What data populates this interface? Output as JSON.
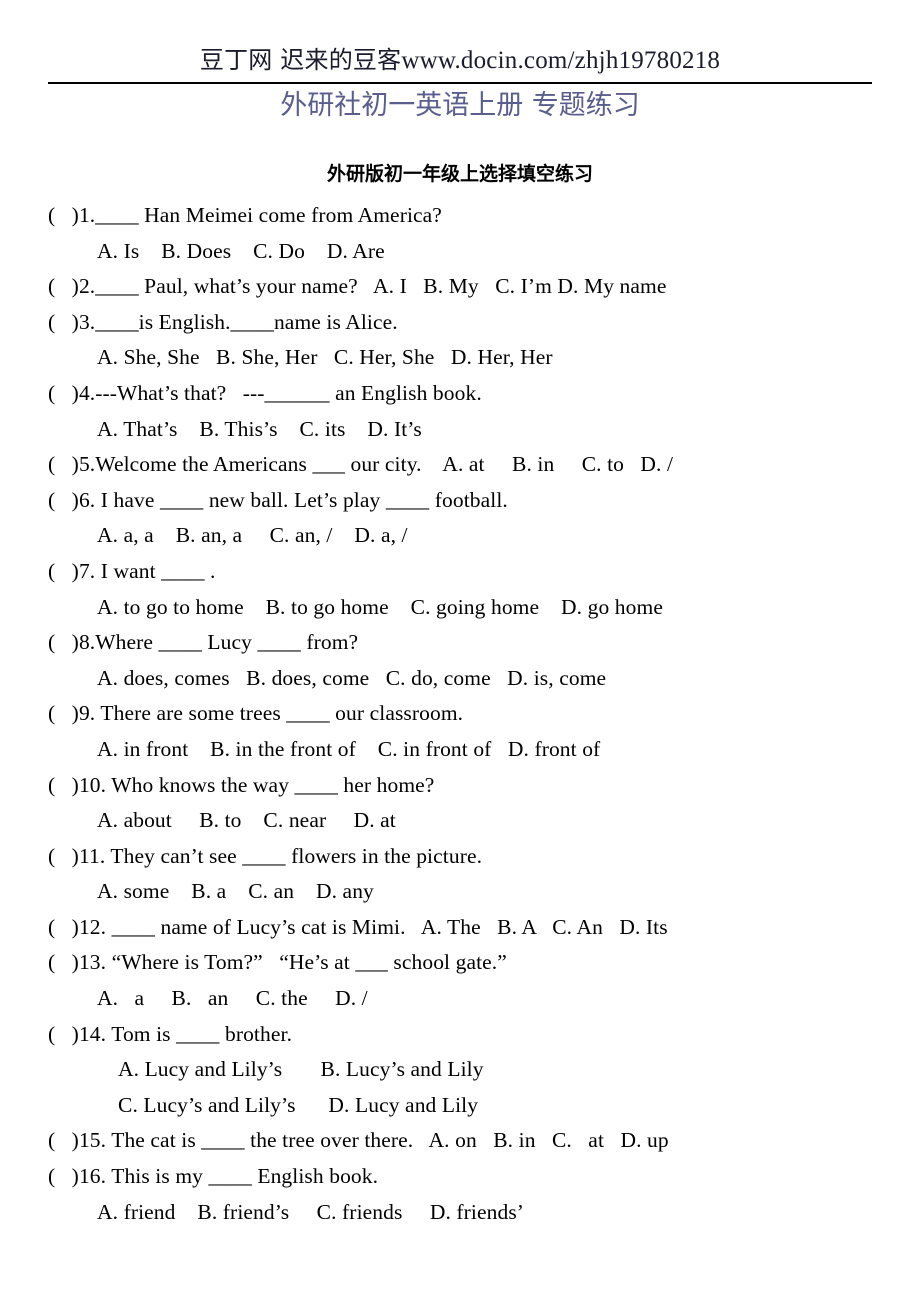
{
  "header": {
    "watermark_cn": "豆丁网  迟来的豆客",
    "watermark_url": "www.docin.com/zhjh19780218"
  },
  "title": "外研社初一英语上册  专题练习",
  "subtitle": "外研版初一年级上选择填空练习",
  "colors": {
    "title_blue": "#5a5e8e",
    "text_black": "#000000",
    "rule": "#000000"
  },
  "lines": [
    {
      "kind": "question",
      "text": "(   )1.____ Han Meimei come from America?"
    },
    {
      "kind": "option",
      "text": "A. Is    B. Does    C. Do    D. Are"
    },
    {
      "kind": "question",
      "text": "(   )2.____ Paul, what’s your name?   A. I   B. My   C. I’m D. My name"
    },
    {
      "kind": "question",
      "text": "(   )3.____is English.____name is Alice."
    },
    {
      "kind": "option",
      "text": "A. She, She   B. She, Her   C. Her, She   D. Her, Her"
    },
    {
      "kind": "question",
      "text": "(   )4.---What’s that?   ---______ an English book."
    },
    {
      "kind": "option",
      "text": "A. That’s    B. This’s    C. its    D. It’s"
    },
    {
      "kind": "question",
      "text": "(   )5.Welcome the Americans ___ our city.    A. at     B. in     C. to   D. /"
    },
    {
      "kind": "question",
      "text": "(   )6. I have ____ new ball. Let’s play ____ football."
    },
    {
      "kind": "option",
      "text": "A. a, a    B. an, a     C. an, /    D. a, /"
    },
    {
      "kind": "question",
      "text": "(   )7. I want ____ ."
    },
    {
      "kind": "option",
      "text": "A. to go to home    B. to go home    C. going home    D. go home"
    },
    {
      "kind": "question",
      "text": "(   )8.Where ____ Lucy ____ from?"
    },
    {
      "kind": "option",
      "text": "A. does, comes   B. does, come   C. do, come   D. is, come"
    },
    {
      "kind": "question",
      "text": "(   )9. There are some trees ____ our classroom."
    },
    {
      "kind": "option",
      "text": "A. in front    B. in the front of    C. in front of   D. front of"
    },
    {
      "kind": "question",
      "text": "(   )10. Who knows the way ____ her home?"
    },
    {
      "kind": "option",
      "text": "A. about     B. to    C. near     D. at"
    },
    {
      "kind": "question",
      "text": "(   )11. They can’t see ____ flowers in the picture."
    },
    {
      "kind": "option",
      "text": "A. some    B. a    C. an    D. any"
    },
    {
      "kind": "question",
      "text": "(   )12. ____ name of Lucy’s cat is Mimi.   A. The   B. A   C. An   D. Its"
    },
    {
      "kind": "question",
      "text": "(   )13. “Where is Tom?”   “He’s at ___ school gate.”"
    },
    {
      "kind": "option",
      "text": "A.   a     B.   an     C. the     D. /"
    },
    {
      "kind": "question",
      "text": "(   )14. Tom is ____ brother."
    },
    {
      "kind": "option2",
      "text": "A. Lucy and Lily’s       B. Lucy’s and Lily"
    },
    {
      "kind": "option2",
      "text": "C. Lucy’s and Lily’s      D. Lucy and Lily"
    },
    {
      "kind": "question",
      "text": "(   )15. The cat is ____ the tree over there.   A. on   B. in   C.   at   D. up"
    },
    {
      "kind": "question",
      "text": "(   )16. This is my ____ English book."
    },
    {
      "kind": "option",
      "text": "A. friend    B. friend’s     C. friends     D. friends’"
    }
  ]
}
